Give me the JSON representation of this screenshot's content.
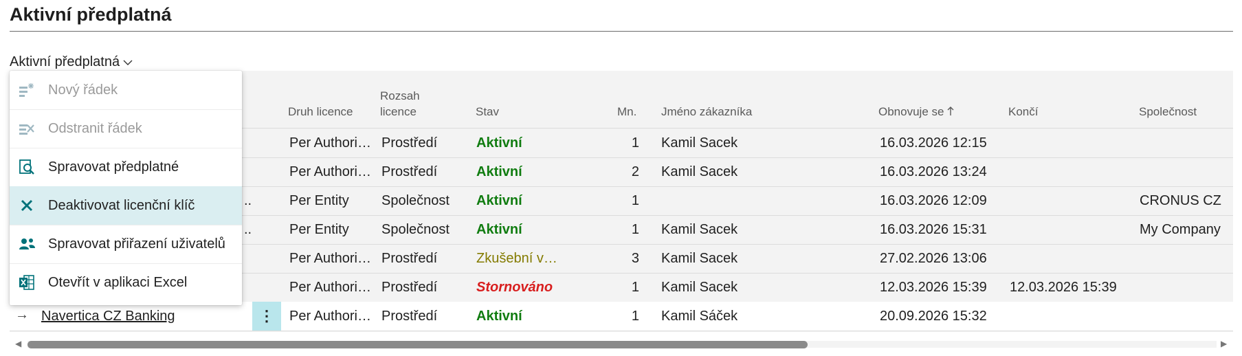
{
  "page": {
    "title": "Aktivní předplatná"
  },
  "view_selector": {
    "label": "Aktivní předplatná"
  },
  "columns": {
    "druh_licence": "Druh licence",
    "rozsah_line1": "Rozsah",
    "rozsah_line2": "licence",
    "stav": "Stav",
    "mn": "Mn.",
    "jmeno": "Jméno zákazníka",
    "obnovuje": "Obnovuje se",
    "konci": "Končí",
    "spolecnost": "Společnost"
  },
  "rows": [
    {
      "druh": "Per Authori…",
      "rozsah": "Prostředí",
      "stav": "Aktivní",
      "mn": "1",
      "jmeno": "Kamil Sacek",
      "obnovuje": "16.03.2026 12:15",
      "konci": "",
      "spolecnost": ""
    },
    {
      "druh": "Per Authori…",
      "rozsah": "Prostředí",
      "stav": "Aktivní",
      "mn": "2",
      "jmeno": "Kamil Sacek",
      "obnovuje": "16.03.2026 13:24",
      "konci": "",
      "spolecnost": ""
    },
    {
      "trunc": "..",
      "druh": "Per Entity",
      "rozsah": "Společnost",
      "stav": "Aktivní",
      "mn": "1",
      "jmeno": "",
      "obnovuje": "16.03.2026 12:09",
      "konci": "",
      "spolecnost": "CRONUS CZ"
    },
    {
      "trunc": "..",
      "druh": "Per Entity",
      "rozsah": "Společnost",
      "stav": "Aktivní",
      "mn": "1",
      "jmeno": "Kamil Sacek",
      "obnovuje": "16.03.2026 15:31",
      "konci": "",
      "spolecnost": "My Company"
    },
    {
      "druh": "Per Authori…",
      "rozsah": "Prostředí",
      "stav": "Zkušební v…",
      "mn": "3",
      "jmeno": "Kamil Sacek",
      "obnovuje": "27.02.2026 13:06",
      "konci": "",
      "spolecnost": ""
    },
    {
      "druh": "Per Authori…",
      "rozsah": "Prostředí",
      "stav": "Stornováno",
      "mn": "1",
      "jmeno": "Kamil Sacek",
      "obnovuje": "12.03.2026 15:39",
      "konci": "12.03.2026 15:39",
      "spolecnost": ""
    },
    {
      "arrow": "→",
      "name": "Navertica CZ Banking",
      "dots": "⋮",
      "druh": "Per Authori…",
      "rozsah": "Prostředí",
      "stav": "Aktivní",
      "mn": "1",
      "jmeno": "Kamil Sáček",
      "obnovuje": "20.09.2026 15:32",
      "konci": "",
      "spolecnost": ""
    }
  ],
  "menu": {
    "items": [
      {
        "label": "Nový řádek",
        "icon": "new-line-icon"
      },
      {
        "label": "Odstranit řádek",
        "icon": "delete-line-icon"
      },
      {
        "label": "Spravovat předplatné",
        "icon": "manage-subscription-icon"
      },
      {
        "label": "Deaktivovat licenční klíč",
        "icon": "close-icon"
      },
      {
        "label": "Spravovat přiřazení uživatelů",
        "icon": "users-icon"
      },
      {
        "label": "Otevřít v aplikaci Excel",
        "icon": "excel-icon"
      }
    ]
  },
  "colors": {
    "active": "#107c10",
    "trial": "#847b00",
    "cancelled": "#d81e1e",
    "highlight": "#daeef1",
    "accent": "#00727a"
  }
}
